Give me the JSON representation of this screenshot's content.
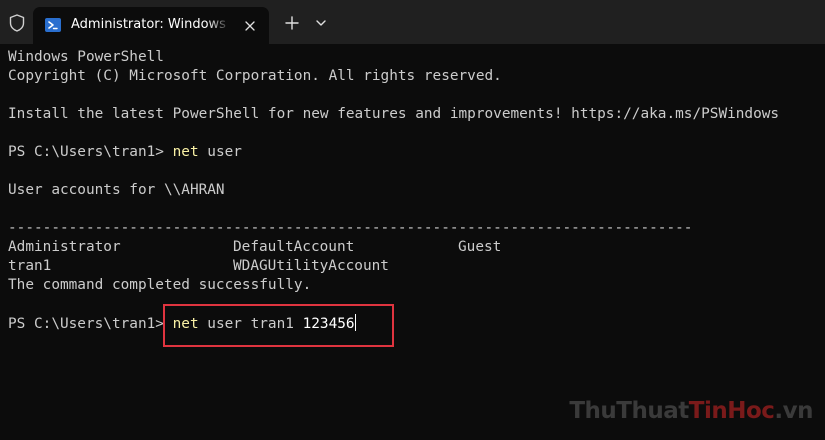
{
  "window": {
    "tab_title": "Administrator: Windows PowerShell",
    "icons": {
      "shield": "shield-icon",
      "tab": "powershell-icon",
      "close": "close-icon",
      "new_tab": "plus-icon",
      "dropdown": "chevron-down-icon"
    },
    "colors": {
      "titlebar": "#202020",
      "background": "#0c0c0c",
      "text": "#cccccc",
      "command": "#f9f1a5",
      "highlight_border": "#e0343f"
    }
  },
  "terminal": {
    "header_1": "Windows PowerShell",
    "header_2": "Copyright (C) Microsoft Corporation. All rights reserved.",
    "install_msg": "Install the latest PowerShell for new features and improvements! https://aka.ms/PSWindows",
    "prompt_1": "PS C:\\Users\\tran1> ",
    "cmd_1_name": "net",
    "cmd_1_args": " user",
    "user_accounts": "User accounts for \\\\AHRAN",
    "separator": "-------------------------------------------------------------------------------",
    "accounts": [
      [
        "Administrator",
        "DefaultAccount",
        "Guest"
      ],
      [
        "tran1",
        "WDAGUtilityAccount",
        ""
      ]
    ],
    "completed": "The command completed successfully.",
    "prompt_2": "PS C:\\Users\\tran1> ",
    "cmd_2_name": "net",
    "cmd_2_args": " user tran1 ",
    "cmd_2_number": "123456"
  },
  "watermark": {
    "part_1": "ThuThuat",
    "part_2": "TinHoc",
    "part_3": ".vn"
  }
}
